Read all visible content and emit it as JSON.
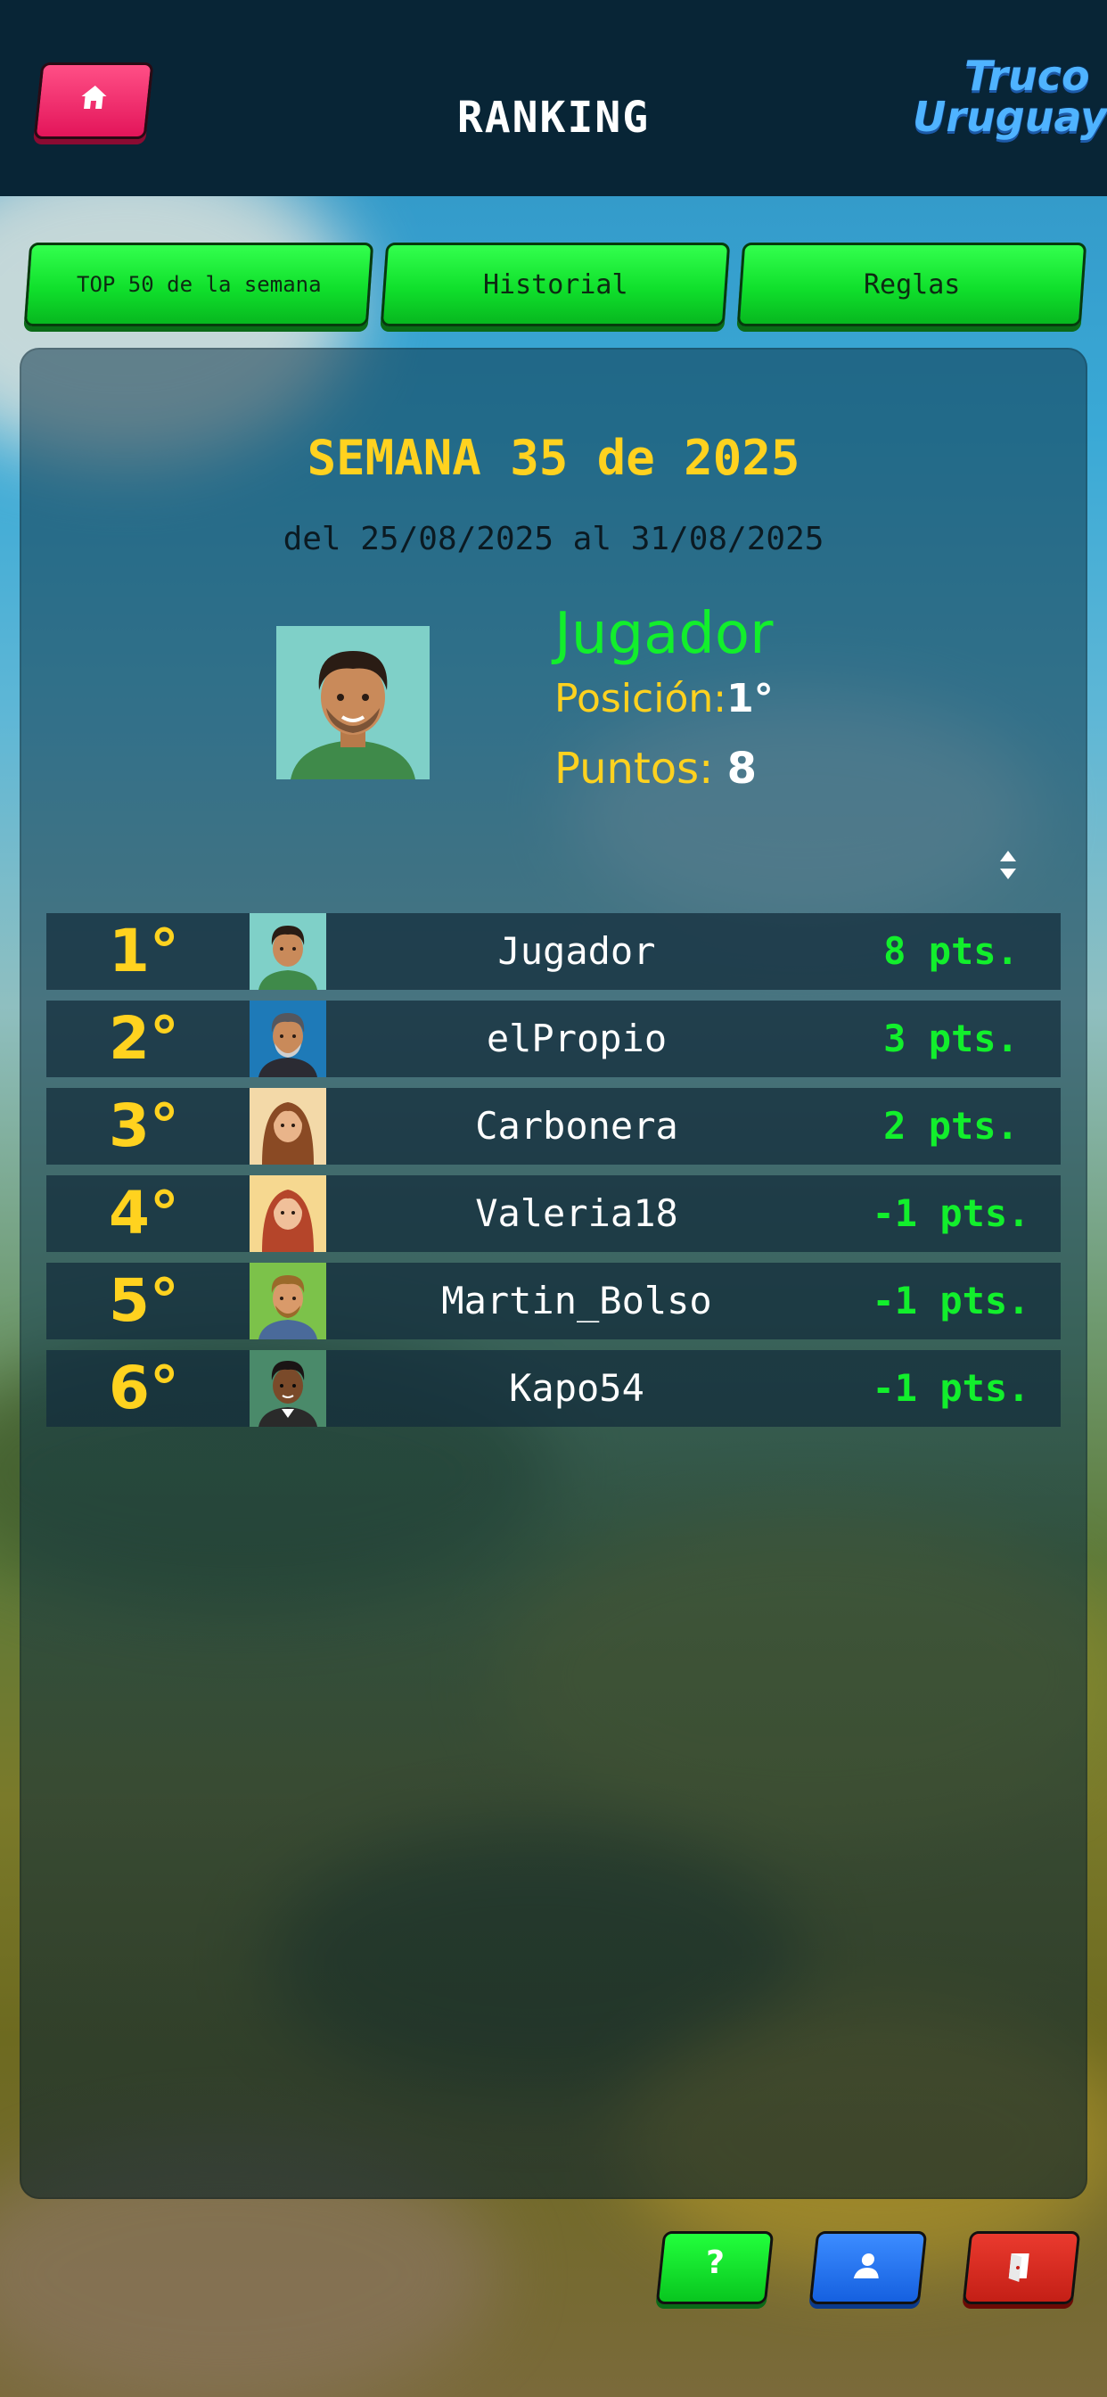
{
  "header": {
    "title": "RANKING",
    "logo_line1": "Truco",
    "logo_line2": "Uruguayo"
  },
  "tabs": [
    {
      "label": "TOP 50 de la semana"
    },
    {
      "label": "Historial"
    },
    {
      "label": "Reglas"
    }
  ],
  "week": {
    "title": "SEMANA 35 de 2025",
    "range": "del 25/08/2025 al 31/08/2025"
  },
  "me": {
    "name": "Jugador",
    "position_label": "Posición:",
    "position_value": "1°",
    "points_label": "Puntos:",
    "points_value": "8"
  },
  "ranking": [
    {
      "rank": "1°",
      "name": "Jugador",
      "points": "8 pts."
    },
    {
      "rank": "2°",
      "name": "elPropio",
      "points": "3 pts."
    },
    {
      "rank": "3°",
      "name": "Carbonera",
      "points": "2 pts."
    },
    {
      "rank": "4°",
      "name": "Valeria18",
      "points": "-1 pts."
    },
    {
      "rank": "5°",
      "name": "Martin_Bolso",
      "points": "-1 pts."
    },
    {
      "rank": "6°",
      "name": "Kapo54",
      "points": "-1 pts."
    }
  ],
  "bottom_buttons": {
    "help_label": "?"
  },
  "icons": [
    "home-icon",
    "sort-icon",
    "help-icon",
    "user-icon",
    "exit-icon"
  ],
  "colors": {
    "accent_yellow": "#ffd21f",
    "accent_green": "#12ef2c",
    "header_bg": "#082536",
    "home_button": "#ff2f73"
  }
}
